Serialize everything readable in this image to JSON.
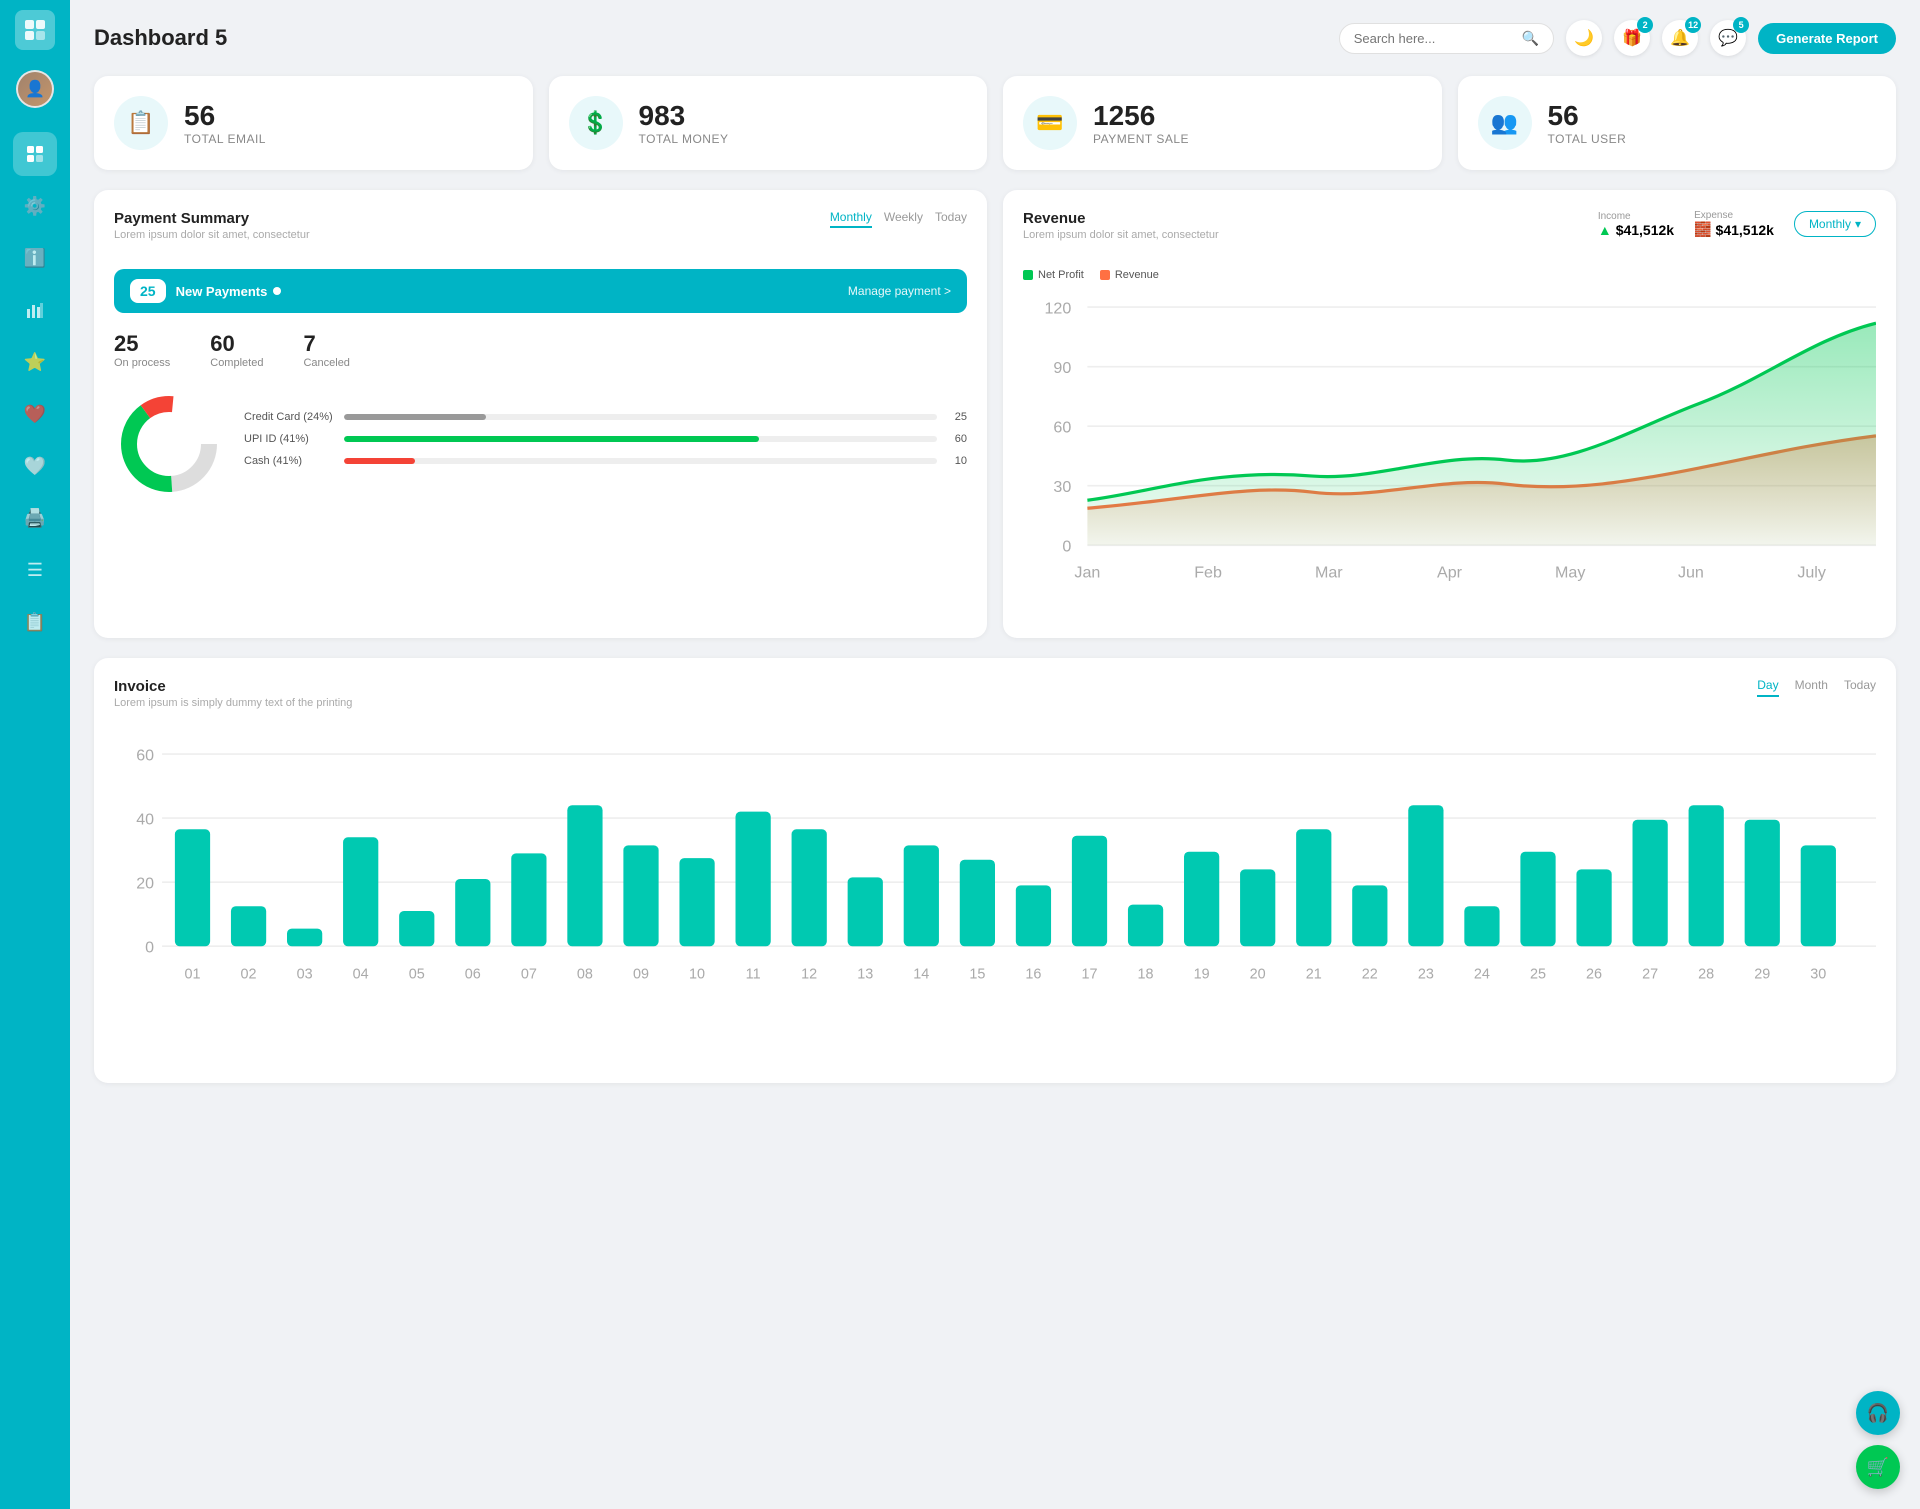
{
  "app": {
    "title": "Dashboard 5"
  },
  "header": {
    "search_placeholder": "Search here...",
    "generate_btn": "Generate Report",
    "badge_gift": "2",
    "badge_bell": "12",
    "badge_chat": "5"
  },
  "stats": [
    {
      "id": "email",
      "icon": "📋",
      "number": "56",
      "label": "TOTAL EMAIL"
    },
    {
      "id": "money",
      "icon": "💲",
      "number": "983",
      "label": "TOTAL MONEY"
    },
    {
      "id": "payment",
      "icon": "💳",
      "number": "1256",
      "label": "PAYMENT SALE"
    },
    {
      "id": "user",
      "icon": "👥",
      "number": "56",
      "label": "TOTAL USER"
    }
  ],
  "payment_summary": {
    "title": "Payment Summary",
    "subtitle": "Lorem ipsum dolor sit amet, consectetur",
    "tabs": [
      "Monthly",
      "Weekly",
      "Today"
    ],
    "active_tab": "Monthly",
    "new_payments": {
      "count": "25",
      "label": "New Payments",
      "link": "Manage payment >"
    },
    "stats": [
      {
        "number": "25",
        "label": "On process"
      },
      {
        "number": "60",
        "label": "Completed"
      },
      {
        "number": "7",
        "label": "Canceled"
      }
    ],
    "progress_bars": [
      {
        "label": "Credit Card (24%)",
        "pct": 24,
        "color": "#999",
        "value": "25"
      },
      {
        "label": "UPI ID (41%)",
        "pct": 41,
        "color": "#00c853",
        "value": "60"
      },
      {
        "label": "Cash (41%)",
        "pct": 10,
        "color": "#f44336",
        "value": "10"
      }
    ]
  },
  "revenue": {
    "title": "Revenue",
    "subtitle": "Lorem ipsum dolor sit amet, consectetur",
    "dropdown": "Monthly",
    "income": {
      "label": "Income",
      "value": "$41,512k"
    },
    "expense": {
      "label": "Expense",
      "value": "$41,512k"
    },
    "legend": [
      {
        "label": "Net Profit",
        "color": "#00c853"
      },
      {
        "label": "Revenue",
        "color": "#ff7043"
      }
    ],
    "x_labels": [
      "Jan",
      "Feb",
      "Mar",
      "Apr",
      "May",
      "Jun",
      "July"
    ],
    "y_labels": [
      "120",
      "90",
      "60",
      "30",
      "0"
    ]
  },
  "invoice": {
    "title": "Invoice",
    "subtitle": "Lorem ipsum is simply dummy text of the printing",
    "tabs": [
      "Day",
      "Month",
      "Today"
    ],
    "active_tab": "Day",
    "y_labels": [
      "60",
      "40",
      "20",
      "0"
    ],
    "x_labels": [
      "01",
      "02",
      "03",
      "04",
      "05",
      "06",
      "07",
      "08",
      "09",
      "10",
      "11",
      "12",
      "13",
      "14",
      "15",
      "16",
      "17",
      "18",
      "19",
      "20",
      "21",
      "22",
      "23",
      "24",
      "25",
      "26",
      "27",
      "28",
      "29",
      "30"
    ],
    "bars": [
      35,
      12,
      5,
      32,
      10,
      20,
      28,
      42,
      30,
      25,
      40,
      35,
      20,
      30,
      25,
      18,
      32,
      12,
      28,
      22,
      35,
      18,
      42,
      12,
      28,
      22,
      38,
      42,
      38,
      30
    ]
  },
  "sidebar": {
    "items": [
      {
        "icon": "⬛",
        "label": "logo"
      },
      {
        "icon": "📊",
        "label": "dashboard",
        "active": true
      },
      {
        "icon": "⚙️",
        "label": "settings"
      },
      {
        "icon": "ℹ️",
        "label": "info"
      },
      {
        "icon": "📈",
        "label": "analytics"
      },
      {
        "icon": "⭐",
        "label": "favorites"
      },
      {
        "icon": "❤️",
        "label": "liked"
      },
      {
        "icon": "🤍",
        "label": "saved"
      },
      {
        "icon": "🖨️",
        "label": "print"
      },
      {
        "icon": "☰",
        "label": "menu"
      },
      {
        "icon": "📋",
        "label": "reports"
      }
    ]
  },
  "float_btns": [
    {
      "icon": "🎧",
      "color": "teal",
      "label": "support"
    },
    {
      "icon": "🛒",
      "color": "green",
      "label": "cart"
    }
  ]
}
